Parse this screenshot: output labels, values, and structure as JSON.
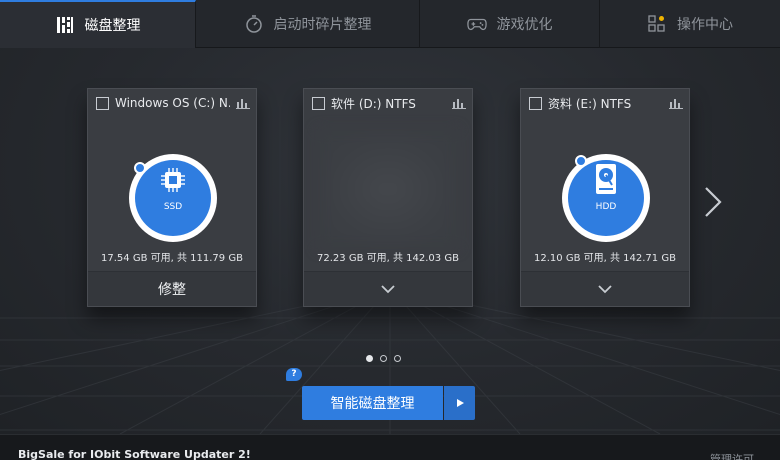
{
  "tabs": [
    {
      "label": "磁盘整理",
      "icon": "defrag-icon",
      "active": true
    },
    {
      "label": "启动时碎片整理",
      "icon": "boot-timer-icon",
      "active": false
    },
    {
      "label": "游戏优化",
      "icon": "gamepad-icon",
      "active": false
    },
    {
      "label": "操作中心",
      "icon": "action-center-icon",
      "active": false
    }
  ],
  "drives": [
    {
      "title": "Windows OS (C:) N...",
      "type_label": "SSD",
      "space": "17.54 GB 可用, 共 111.79 GB",
      "action": "修整",
      "used_fraction": 0.84,
      "icon": "ssd-chip-icon",
      "expanded": true
    },
    {
      "title": "软件 (D:) NTFS",
      "type_label": "",
      "space": "72.23 GB 可用, 共 142.03 GB",
      "action": "",
      "icon": "chevron-down-icon",
      "expanded": false
    },
    {
      "title": "资料 (E:) NTFS",
      "type_label": "HDD",
      "space": "12.10 GB 可用, 共 142.71 GB",
      "action": "",
      "used_fraction": 0.92,
      "icon": "hdd-icon",
      "expanded": false
    }
  ],
  "pagination": {
    "pages": 3,
    "current": 1
  },
  "smart_defrag_button": "智能磁盘整理",
  "help_badge": "?",
  "footer": {
    "promo": "BigSale for IObit Software Updater 2!",
    "manage": "管理许可"
  },
  "colors": {
    "accent": "#2f7de0",
    "ring_bg": "#ffffff"
  }
}
